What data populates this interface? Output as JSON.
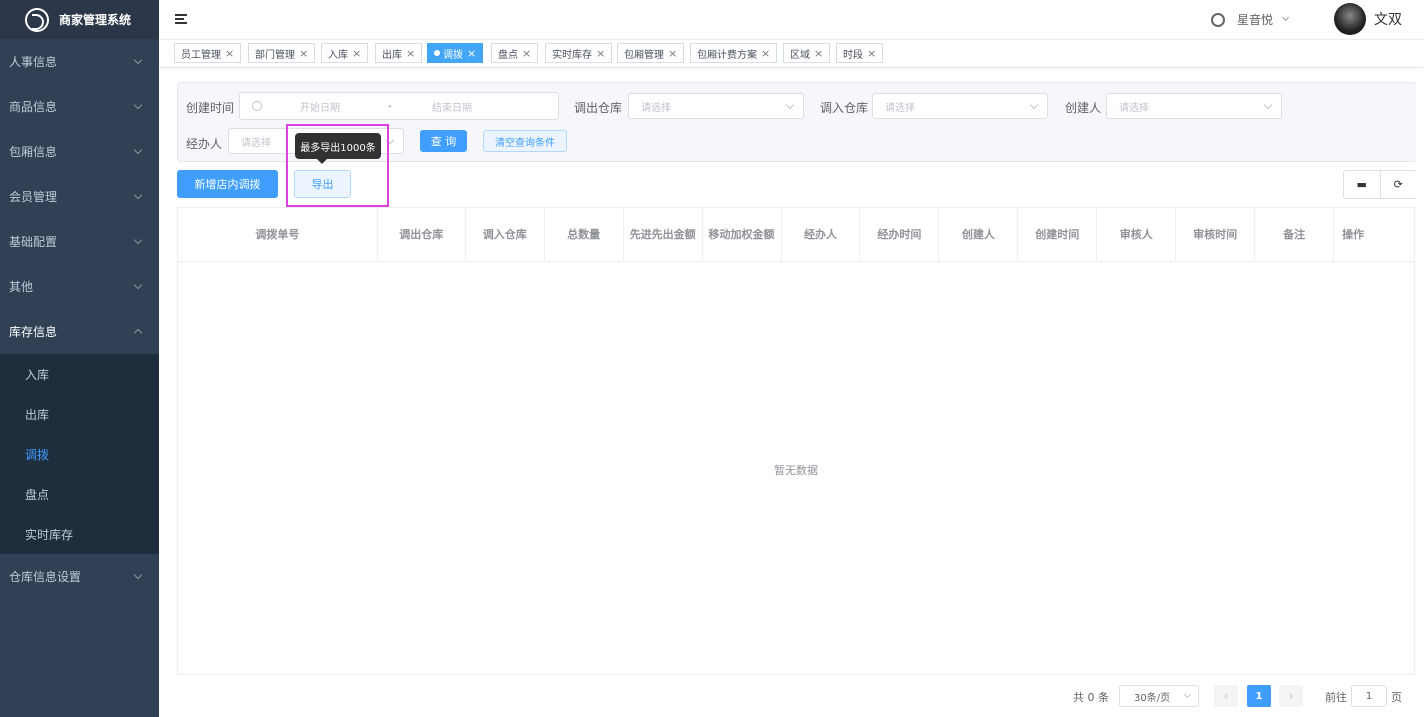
{
  "app": {
    "title": "商家管理系统"
  },
  "sidebar": {
    "items": [
      {
        "label": "人事信息"
      },
      {
        "label": "商品信息"
      },
      {
        "label": "包厢信息"
      },
      {
        "label": "会员管理"
      },
      {
        "label": "基础配置"
      },
      {
        "label": "其他"
      },
      {
        "label": "库存信息"
      }
    ],
    "sub_items": [
      {
        "label": "入库"
      },
      {
        "label": "出库"
      },
      {
        "label": "调拨"
      },
      {
        "label": "盘点"
      },
      {
        "label": "实时库存"
      }
    ],
    "after": {
      "label": "仓库信息设置"
    }
  },
  "header": {
    "store": "星音悦",
    "user": "文双"
  },
  "tabs": [
    "员工管理",
    "部门管理",
    "入库",
    "出库",
    "调拨",
    "盘点",
    "实时库存",
    "包厢管理",
    "包厢计费方案",
    "区域",
    "时段"
  ],
  "filter": {
    "create_time_label": "创建时间",
    "start_placeholder": "开始日期",
    "range_sep": "-",
    "end_placeholder": "结束日期",
    "out_wh_label": "调出仓库",
    "out_wh_placeholder": "请选择",
    "in_wh_label": "调入仓库",
    "in_wh_placeholder": "请选择",
    "creator_label": "创建人",
    "creator_placeholder": "请选择",
    "handler_label": "经办人",
    "handler_placeholder": "请选择",
    "query_button": "查 询",
    "clear_button": "清空查询条件"
  },
  "tooltip": "最多导出1000条",
  "actions": {
    "add_button": "新增店内调拨",
    "export_button": "导出"
  },
  "table": {
    "columns": [
      "调拨单号",
      "调出仓库",
      "调入仓库",
      "总数量",
      "先进先出金额",
      "移动加权金额",
      "经办人",
      "经办时间",
      "创建人",
      "创建时间",
      "审核人",
      "审核时间",
      "备注",
      "操作"
    ],
    "empty_text": "暂无数据"
  },
  "pagination": {
    "total_text": "共 0 条",
    "page_size": "30条/页",
    "current_page": "1",
    "goto_label": "前往",
    "goto_value": "1",
    "page_suffix": "页"
  },
  "colors": {
    "sidebar_bg": "#304156",
    "accent": "#409eff",
    "highlight": "#e040e0"
  }
}
